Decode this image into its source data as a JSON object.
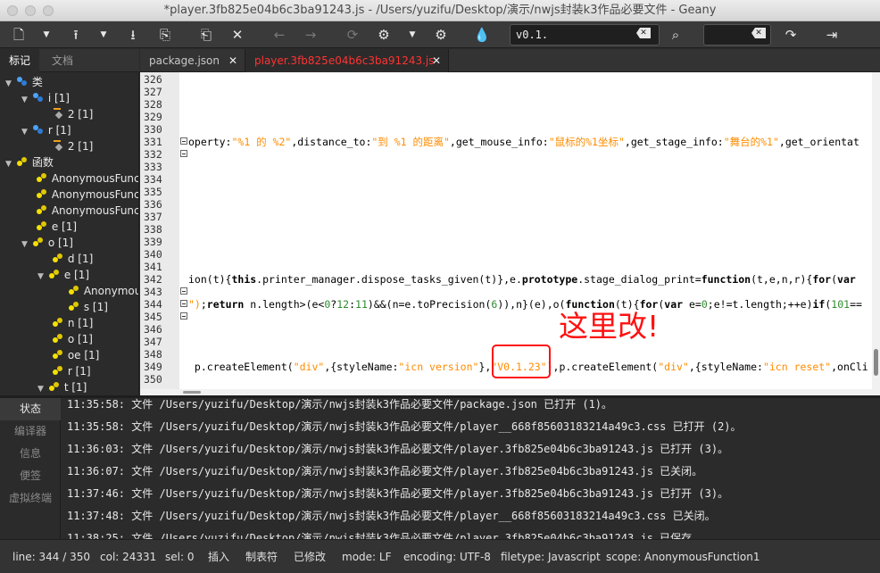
{
  "window": {
    "title": "*player.3fb825e04b6c3ba91243.js - /Users/yuzifu/Desktop/演示/nwjs封装k3作品必要文件 - Geany"
  },
  "toolbar": {
    "search_value": "v0.1.",
    "search_value2": "",
    "icons": [
      "new-icon",
      "open-icon",
      "save-icon",
      "save-all-icon",
      "revert-icon",
      "close-icon",
      "back-icon",
      "forward-icon",
      "reload-icon",
      "build-icon",
      "run-icon",
      "color-icon",
      "search-icon",
      "jump-icon",
      "quit-icon"
    ]
  },
  "sidebar": {
    "tabs": [
      {
        "label": "标记"
      },
      {
        "label": "文档"
      }
    ],
    "tree": [
      {
        "label": "类",
        "type": "class",
        "level": 0
      },
      {
        "label": "i [1]",
        "type": "class",
        "level": 1
      },
      {
        "label": "2 [1]",
        "type": "var",
        "level": 2
      },
      {
        "label": "r [1]",
        "type": "class",
        "level": 1
      },
      {
        "label": "2 [1]",
        "type": "var",
        "level": 2
      },
      {
        "label": "函数",
        "type": "func",
        "level": 0
      },
      {
        "label": "AnonymousFunction",
        "type": "func",
        "level": 1
      },
      {
        "label": "AnonymousFunction",
        "type": "func",
        "level": 1
      },
      {
        "label": "AnonymousFunction",
        "type": "func",
        "level": 1
      },
      {
        "label": "e [1]",
        "type": "func",
        "level": 1
      },
      {
        "label": "o [1]",
        "type": "func",
        "level": 1
      },
      {
        "label": "d [1]",
        "type": "func",
        "level": 2
      },
      {
        "label": "e [1]",
        "type": "func",
        "level": 2
      },
      {
        "label": "Anonymous",
        "type": "func",
        "level": 3
      },
      {
        "label": "s [1]",
        "type": "func",
        "level": 3
      },
      {
        "label": "n [1]",
        "type": "func",
        "level": 2
      },
      {
        "label": "o [1]",
        "type": "func",
        "level": 2
      },
      {
        "label": "oe [1]",
        "type": "func",
        "level": 2
      },
      {
        "label": "r [1]",
        "type": "func",
        "level": 2
      },
      {
        "label": "t [1]",
        "type": "func",
        "level": 2
      }
    ]
  },
  "editor": {
    "tabs": [
      {
        "label": "package.json"
      },
      {
        "label": "player.3fb825e04b6c3ba91243.js"
      }
    ],
    "line_numbers": [
      "326",
      "327",
      "328",
      "329",
      "330",
      "331",
      "332",
      "333",
      "334",
      "335",
      "336",
      "337",
      "338",
      "339",
      "340",
      "341",
      "342",
      "343",
      "344",
      "345",
      "346",
      "347",
      "348",
      "349",
      "350"
    ],
    "lines": {
      "l331a": "operty:",
      "l331b": "\"%1 的 %2\"",
      "l331c": ",distance_to:",
      "l331d": "\"到 %1 的距离\"",
      "l331e": ",get_mouse_info:",
      "l331f": "\"鼠标的%1坐标\"",
      "l331g": ",get_stage_info:",
      "l331h": "\"舞台的%1\"",
      "l331i": ",get_orientat",
      "l342a": "ion(t){",
      "l342b": "this",
      "l342c": ".printer_manager.dispose_tasks_given(t)},e.",
      "l342d": "prototype",
      "l342e": ".stage_dialog_print=",
      "l342f": "function",
      "l342g": "(t,e,n,r){",
      "l342h": "for",
      "l342i": "(",
      "l342j": "var",
      "l344a": "\")",
      "l344b": ";",
      "l344c": "return",
      "l344d": " n.length>(e<",
      "l344e": "0",
      "l344f": "?",
      "l344g": "12",
      "l344h": ":",
      "l344i": "11",
      "l344j": ")&&(n=e.toPrecision(",
      "l344k": "6",
      "l344l": ")),n}(e),o(",
      "l344m": "function",
      "l344n": "(t){",
      "l344o": "for",
      "l344p": "(",
      "l344q": "var",
      "l344r": " e=",
      "l344s": "0",
      "l344t": ";e!=t.length;++e)",
      "l344u": "if",
      "l344v": "(",
      "l344w": "101",
      "l344x": "==",
      "l349a": " p.createElement(",
      "l349b": "\"div\"",
      "l349c": ",{styleName:",
      "l349d": "\"icn version\"",
      "l349e": "},",
      "l349f": "\"V0.1.23\"",
      "l349g": "),p.createElement(",
      "l349h": "\"div\"",
      "l349i": ",{styleName:",
      "l349j": "\"icn reset\"",
      "l349k": ",onCli"
    },
    "annotation": "这里改!"
  },
  "messages": {
    "tabs": [
      {
        "label": "状态"
      },
      {
        "label": "编译器"
      },
      {
        "label": "信息"
      },
      {
        "label": "便签"
      },
      {
        "label": "虚拟终端"
      }
    ],
    "log": [
      "11:35:58: 文件 /Users/yuzifu/Desktop/演示/nwjs封装k3作品必要文件/package.json 已打开 (1)。",
      "11:35:58: 文件 /Users/yuzifu/Desktop/演示/nwjs封装k3作品必要文件/player__668f85603183214a49c3.css 已打开 (2)。",
      "11:36:03: 文件 /Users/yuzifu/Desktop/演示/nwjs封装k3作品必要文件/player.3fb825e04b6c3ba91243.js 已打开 (3)。",
      "11:36:07: 文件 /Users/yuzifu/Desktop/演示/nwjs封装k3作品必要文件/player.3fb825e04b6c3ba91243.js 已关闭。",
      "11:37:46: 文件 /Users/yuzifu/Desktop/演示/nwjs封装k3作品必要文件/player.3fb825e04b6c3ba91243.js 已打开 (3)。",
      "11:37:48: 文件 /Users/yuzifu/Desktop/演示/nwjs封装k3作品必要文件/player__668f85603183214a49c3.css 已关闭。",
      "11:38:25: 文件 /Users/yuzifu/Desktop/演示/nwjs封装k3作品必要文件/player.3fb825e04b6c3ba91243.js 已保存。"
    ]
  },
  "status": {
    "line": "line: 344 / 350",
    "col": "col: 24331",
    "sel": "sel: 0",
    "mode_insert": "插入",
    "indent": "制表符",
    "modified": "已修改",
    "eol": "mode: LF",
    "encoding": "encoding: UTF-8",
    "filetype": "filetype: Javascript",
    "scope": "scope: AnonymousFunction1"
  }
}
